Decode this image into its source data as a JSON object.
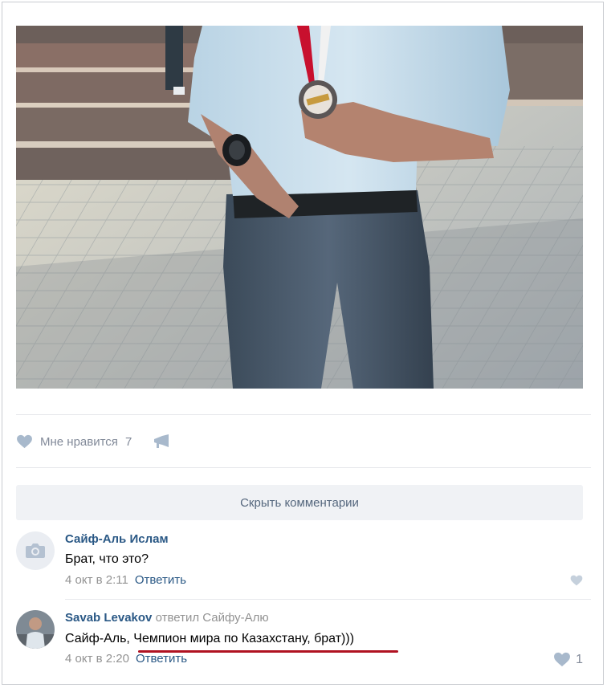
{
  "post": {
    "likes": {
      "label": "Мне нравится",
      "count": "7"
    },
    "hide_comments": "Скрыть комментарии"
  },
  "comments": [
    {
      "author": "Сайф-Аль Ислам",
      "text": "Брат, что это?",
      "date": "4 окт в 2:11",
      "reply": "Ответить",
      "likes": ""
    },
    {
      "author": "Savab Levakov",
      "reply_to": "ответил Сайфу-Алю",
      "text_prefix": "Сайф-Аль, ",
      "text_body": "Чемпион мира по Казахстану, брат)))",
      "date": "4 окт в 2:20",
      "reply": "Ответить",
      "likes": "1"
    }
  ],
  "colors": {
    "link": "#2a5885",
    "muted": "#939393",
    "highlight_underline": "#b01221"
  }
}
